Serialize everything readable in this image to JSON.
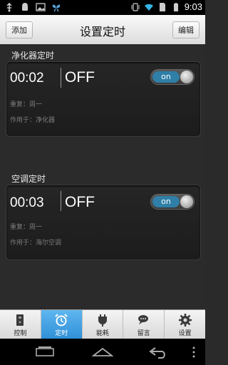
{
  "status_bar": {
    "time": "9:03",
    "icons_left": [
      "usb-icon",
      "android-icon",
      "image-icon",
      "butterfly-icon"
    ],
    "icons_right": [
      "vibrate-icon",
      "wifi-icon",
      "sim-icon",
      "battery-icon"
    ]
  },
  "header": {
    "add_label": "添加",
    "title": "设置定时",
    "edit_label": "编辑"
  },
  "timers": [
    {
      "section": "净化器定时",
      "time": "00:02",
      "state": "OFF",
      "switch": "on",
      "repeat": "重复：周一",
      "applies_to": "作用于：净化器"
    },
    {
      "section": "空调定时",
      "time": "00:03",
      "state": "OFF",
      "switch": "on",
      "repeat": "重复：周一",
      "applies_to": "作用于：海尔空调"
    }
  ],
  "tabs": [
    {
      "label": "控制",
      "icon": "device-icon",
      "active": false
    },
    {
      "label": "定时",
      "icon": "alarm-clock-icon",
      "active": true
    },
    {
      "label": "能耗",
      "icon": "plug-icon",
      "active": false
    },
    {
      "label": "留言",
      "icon": "chat-icon",
      "active": false
    },
    {
      "label": "设置",
      "icon": "gear-icon",
      "active": false
    }
  ],
  "colors": {
    "accent": "#2f8fd6",
    "switch_on": "#2f7fa8"
  }
}
